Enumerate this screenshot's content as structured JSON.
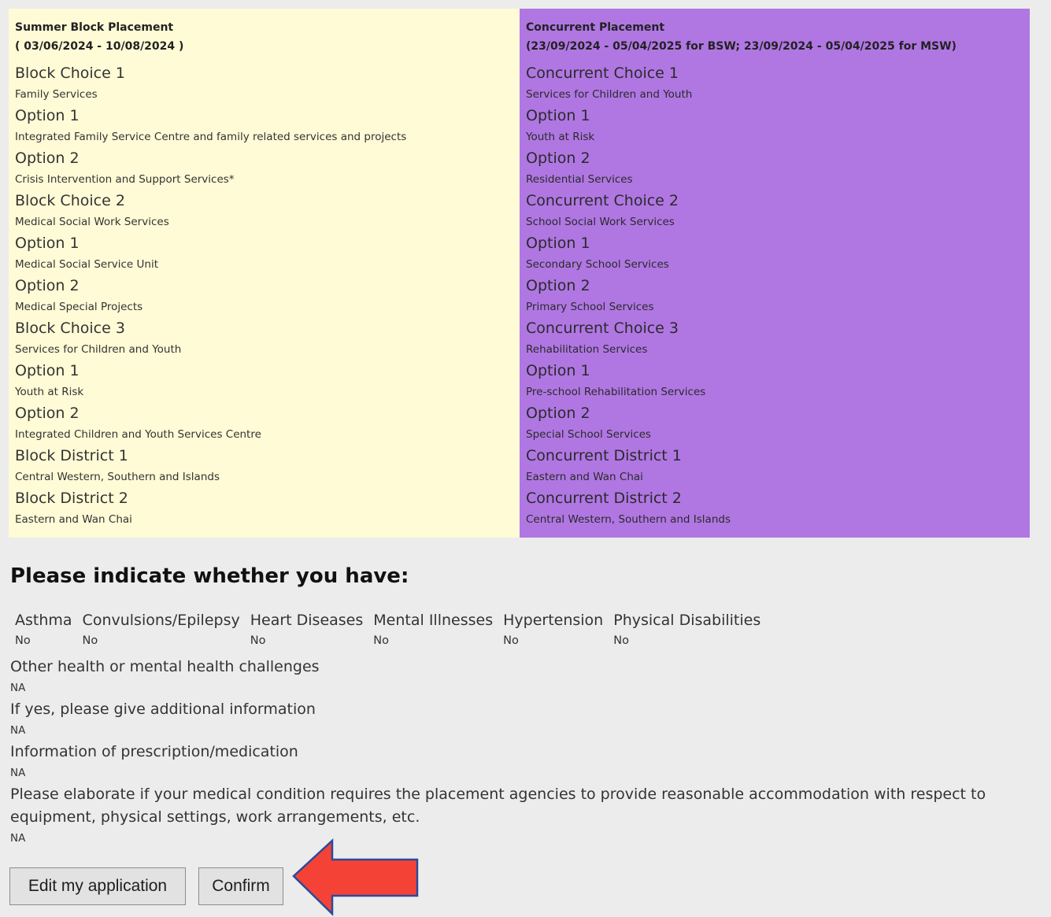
{
  "block": {
    "title": "Summer Block Placement",
    "dates": "( 03/06/2024 - 10/08/2024 )",
    "entries": [
      {
        "label": "Block Choice 1",
        "value": "Family Services"
      },
      {
        "label": "Option 1",
        "value": "Integrated Family Service Centre and family related services and projects"
      },
      {
        "label": "Option 2",
        "value": "Crisis Intervention and Support Services*"
      },
      {
        "label": "Block Choice 2",
        "value": "Medical Social Work Services"
      },
      {
        "label": "Option 1",
        "value": "Medical Social Service Unit"
      },
      {
        "label": "Option 2",
        "value": "Medical Special Projects"
      },
      {
        "label": "Block Choice 3",
        "value": "Services for Children and Youth"
      },
      {
        "label": "Option 1",
        "value": "Youth at Risk"
      },
      {
        "label": "Option 2",
        "value": "Integrated Children and Youth Services Centre"
      },
      {
        "label": "Block District 1",
        "value": "Central Western, Southern and Islands"
      },
      {
        "label": "Block District 2",
        "value": "Eastern and Wan Chai"
      }
    ]
  },
  "concurrent": {
    "title": "Concurrent Placement",
    "dates": "(23/09/2024 - 05/04/2025 for BSW; 23/09/2024 - 05/04/2025 for MSW)",
    "entries": [
      {
        "label": "Concurrent Choice 1",
        "value": "Services for Children and Youth"
      },
      {
        "label": "Option 1",
        "value": "Youth at Risk"
      },
      {
        "label": "Option 2",
        "value": "Residential Services"
      },
      {
        "label": "Concurrent Choice 2",
        "value": "School Social Work Services"
      },
      {
        "label": "Option 1",
        "value": "Secondary School Services"
      },
      {
        "label": "Option 2",
        "value": "Primary School Services"
      },
      {
        "label": "Concurrent Choice 3",
        "value": "Rehabilitation Services"
      },
      {
        "label": "Option 1",
        "value": "Pre-school Rehabilitation Services"
      },
      {
        "label": "Option 2",
        "value": "Special School Services"
      },
      {
        "label": "Concurrent District 1",
        "value": "Eastern and Wan Chai"
      },
      {
        "label": "Concurrent District 2",
        "value": "Central Western, Southern and Islands"
      }
    ]
  },
  "health": {
    "heading": "Please indicate whether you have:",
    "conditions": [
      {
        "label": "Asthma",
        "value": "No"
      },
      {
        "label": "Convulsions/Epilepsy",
        "value": "No"
      },
      {
        "label": "Heart Diseases",
        "value": "No"
      },
      {
        "label": "Mental Illnesses",
        "value": "No"
      },
      {
        "label": "Hypertension",
        "value": "No"
      },
      {
        "label": "Physical Disabilities",
        "value": "No"
      }
    ],
    "questions": [
      {
        "label": "Other health or mental health challenges",
        "value": "NA"
      },
      {
        "label": "If yes, please give additional information",
        "value": "NA"
      },
      {
        "label": "Information of prescription/medication",
        "value": "NA"
      },
      {
        "label": "Please elaborate if your medical condition requires the placement agencies to provide reasonable accommodation with respect to equipment, physical settings, work arrangements, etc.",
        "value": "NA"
      }
    ]
  },
  "buttons": {
    "edit_label": "Edit my application",
    "confirm_label": "Confirm"
  },
  "colors": {
    "block_bg": "#fffbd6",
    "concurrent_bg": "#b077e3",
    "page_bg": "#ececec",
    "arrow_fill": "#f44336",
    "arrow_stroke": "#2b4a9a"
  },
  "icons": {
    "pointer": "red-arrow-left-icon"
  }
}
